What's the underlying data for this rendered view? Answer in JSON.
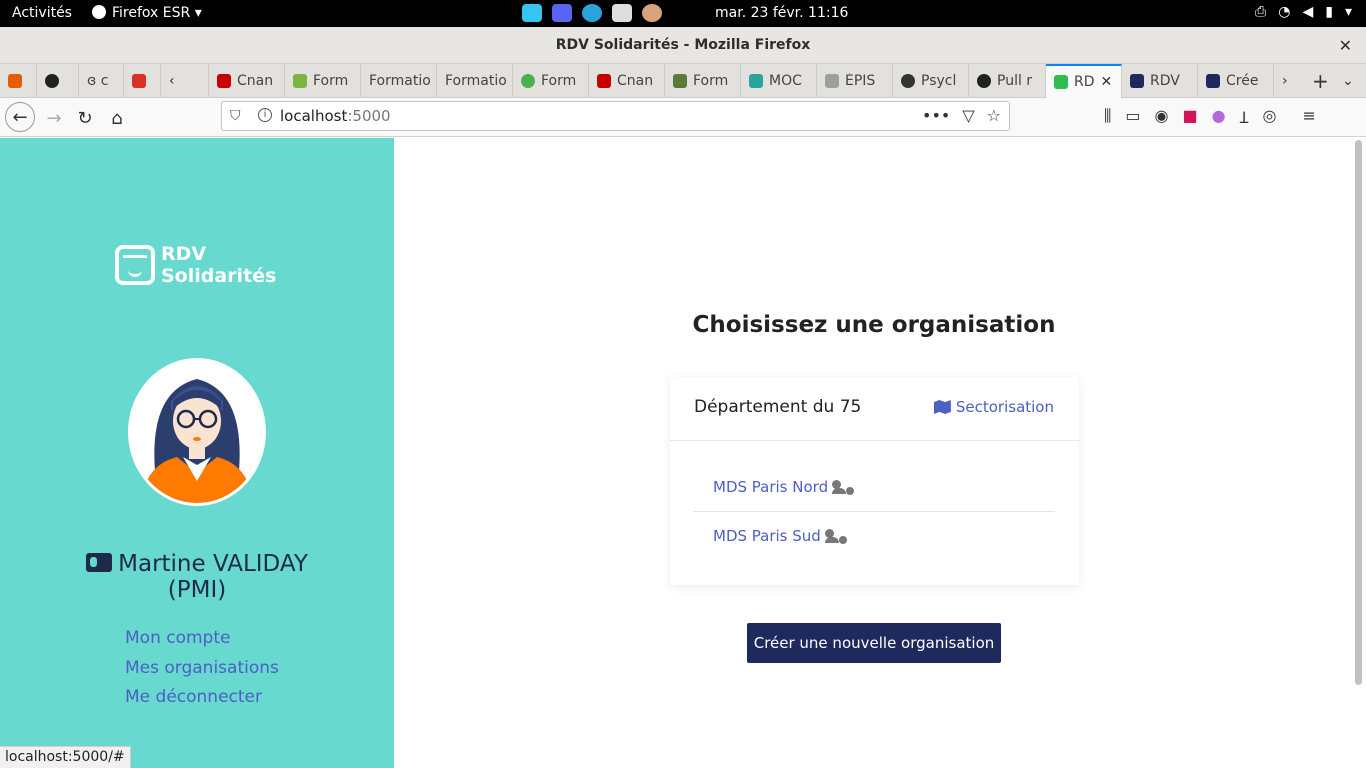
{
  "os_topbar": {
    "activities": "Activités",
    "app_name": "Firefox ESR",
    "clock": "mar. 23 févr.  11:16"
  },
  "window": {
    "title": "RDV Solidarités - Mozilla Firefox"
  },
  "tabs": [
    {
      "label": "",
      "fav_color": "#e35d00"
    },
    {
      "label": "",
      "fav_color": "#222222"
    },
    {
      "label": "ɞ c",
      "fav_color": "#ffffff"
    },
    {
      "label": "",
      "fav_color": "#d93025"
    },
    {
      "label": "Cnan",
      "fav_color": "#c40000"
    },
    {
      "label": "Form",
      "fav_color": "#7cb342"
    },
    {
      "label": "Formatio",
      "fav_color": "#ffffff"
    },
    {
      "label": "Formatio",
      "fav_color": "#ffffff"
    },
    {
      "label": "Form",
      "fav_color": "#4caf50"
    },
    {
      "label": "Cnan",
      "fav_color": "#c40000"
    },
    {
      "label": "Form",
      "fav_color": "#5d7a3a"
    },
    {
      "label": "MOC",
      "fav_color": "#26a69a"
    },
    {
      "label": "ÉPIS",
      "fav_color": "#9e9e9e"
    },
    {
      "label": "Psycl",
      "fav_color": "#333333"
    },
    {
      "label": "Pull r",
      "fav_color": "#222222"
    },
    {
      "label": "RD",
      "fav_color": "#2ebc4f"
    },
    {
      "label": "RDV",
      "fav_color": "#1e2a5e"
    },
    {
      "label": "Crée",
      "fav_color": "#1e2a5e"
    }
  ],
  "urlbar": {
    "host": "localhost",
    "port": ":5000"
  },
  "sidebar": {
    "logo_line1": "RDV",
    "logo_line2": "Solidarités",
    "user_name": "Martine VALIDAY",
    "user_role": "(PMI)",
    "links": [
      "Mon compte",
      "Mes organisations",
      "Me déconnecter"
    ]
  },
  "main": {
    "title": "Choisissez une organisation",
    "department": "Département du 75",
    "sectorisation": "Sectorisation",
    "organisations": [
      "MDS Paris Nord",
      "MDS Paris Sud"
    ],
    "create_button": "Créer une nouvelle organisation"
  },
  "status_bar_url": "localhost:5000/#",
  "colors": {
    "sidebar_bg": "#67d9cf",
    "link": "#4c5fc4",
    "primary_button": "#1e2a5e",
    "active_tab_accent": "#0a84ff"
  }
}
